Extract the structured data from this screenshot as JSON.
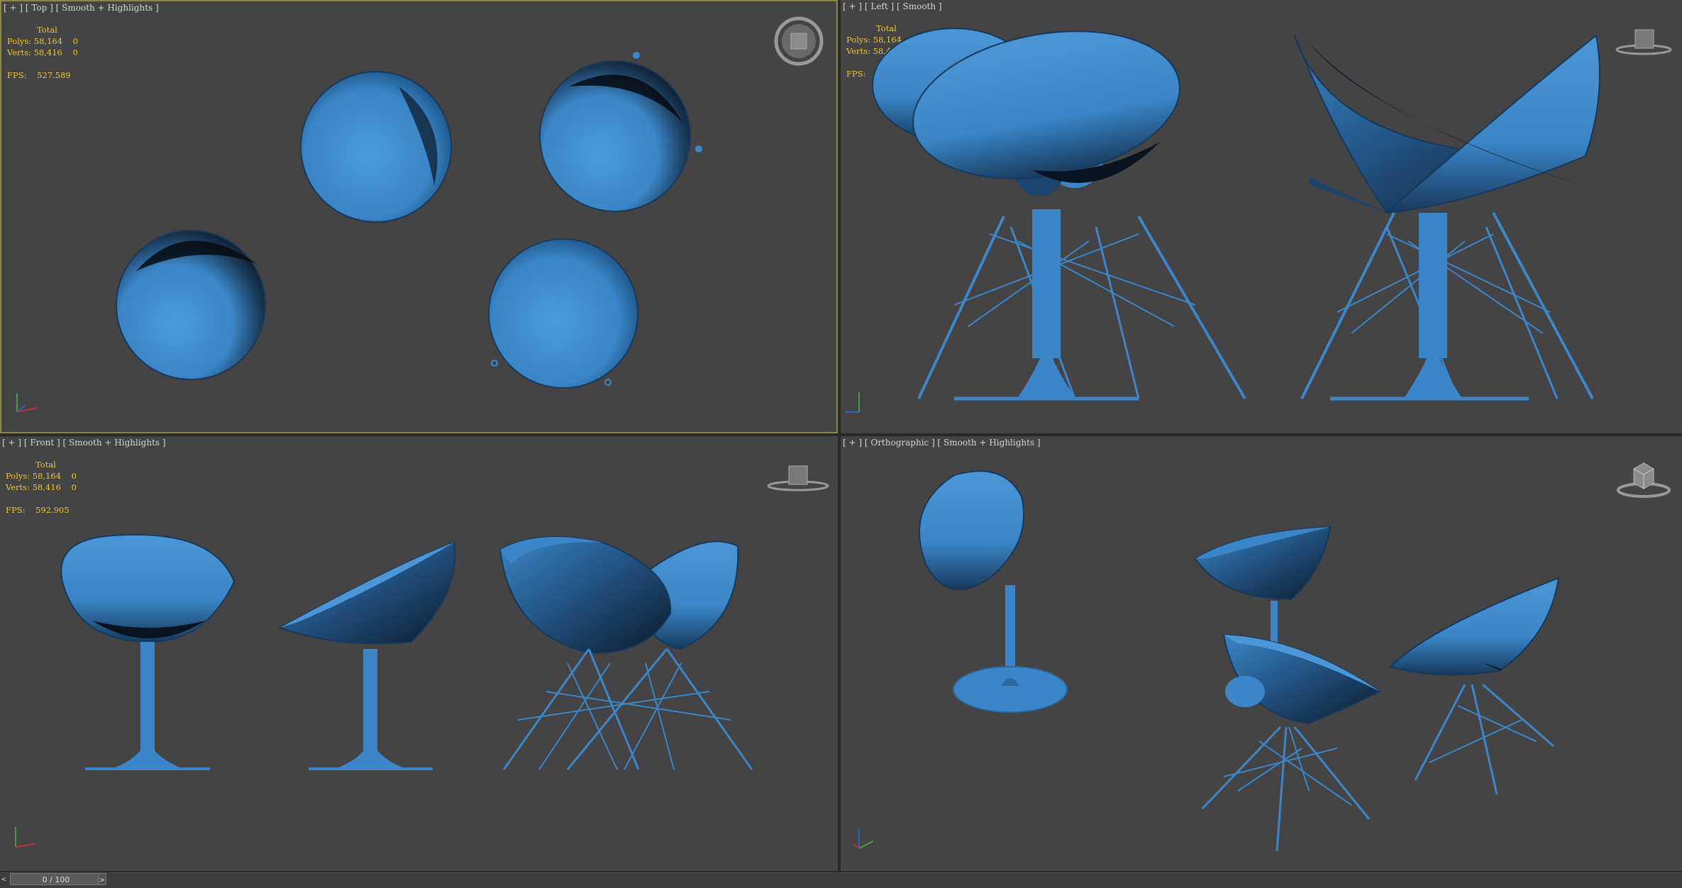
{
  "viewports": {
    "top": {
      "label": "[ + ] [ Top ] [ Smooth + Highlights ]",
      "stats": {
        "header": "Total",
        "polys": "Polys: 58,164    0",
        "verts": "Verts: 58,416    0",
        "fps": "FPS:    527.589"
      }
    },
    "left": {
      "label": "[ + ] [ Left ] [ Smooth ]",
      "stats": {
        "header": "Total",
        "polys": "Polys: 58,164    0",
        "verts": "Verts: 58,416    0",
        "fps": "FPS:    535.536"
      }
    },
    "front": {
      "label": "[ + ] [ Front ] [ Smooth + Highlights ]",
      "stats": {
        "header": "Total",
        "polys": "Polys: 58,164    0",
        "verts": "Verts: 58,416    0",
        "fps": "FPS:    592.905"
      }
    },
    "ortho": {
      "label": "[ + ] [ Orthographic ] [ Smooth + Highlights ]"
    }
  },
  "timeline": {
    "frame": "0 / 100",
    "prev": "<",
    "next": ">"
  },
  "colors": {
    "object": "#3a86c8",
    "background": "#444444",
    "active_border": "#8a8a3a",
    "stats_text": "#e8c832"
  }
}
